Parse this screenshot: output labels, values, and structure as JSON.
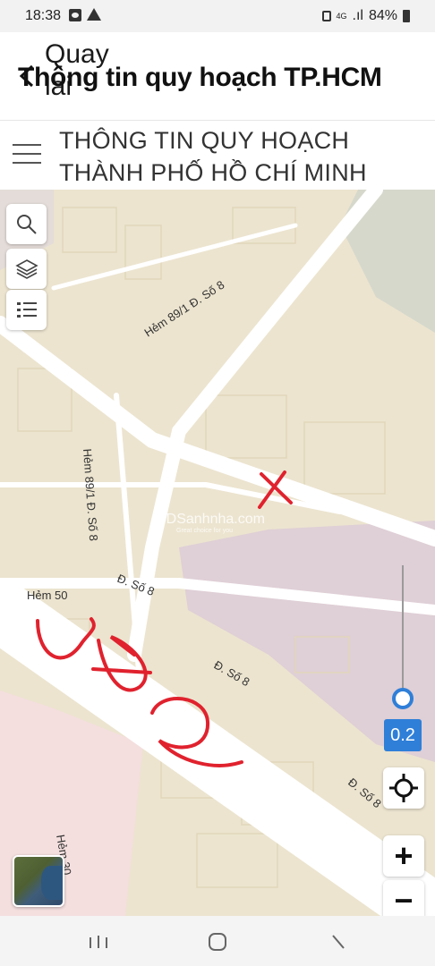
{
  "status_bar": {
    "time": "18:38",
    "network": "4G",
    "signal": ".ıl",
    "battery": "84%",
    "icons": [
      "photo-icon",
      "warning-icon",
      "lock-icon",
      "signal-icon",
      "battery-icon"
    ]
  },
  "header": {
    "back_label_line1": "Quay",
    "back_label_line2": "lai",
    "title": "Thông tin quy hoạch TP.HCM"
  },
  "sub_header": {
    "line1": "THÔNG TIN QUY HOẠCH",
    "line2": "THÀNH PHỐ HỒ CHÍ MINH"
  },
  "map": {
    "street_labels": {
      "hem_89_top": "Hẻm 89/1 Đ. Số 8",
      "hem_89_left": "Hẻm 89/1 Đ. Số 8",
      "hem_50": "Hẻm 50",
      "so8_a": "Đ. Số 8",
      "so8_b": "Đ. Số 8",
      "so8_c": "Đ. Số 8",
      "hem_30": "Hẻm 30"
    },
    "watermark": "BDSanhnha.com",
    "watermark_sub": "Great choice for you",
    "zoom_value": "0.2",
    "zoom_in_label": "+",
    "zoom_out_label": "−"
  },
  "colors": {
    "accent": "#2f7fd8",
    "annotation": "#e0222e",
    "map_base": "#ece4cf",
    "road": "#ffffff",
    "planning_zone": "#dfcfd6"
  }
}
